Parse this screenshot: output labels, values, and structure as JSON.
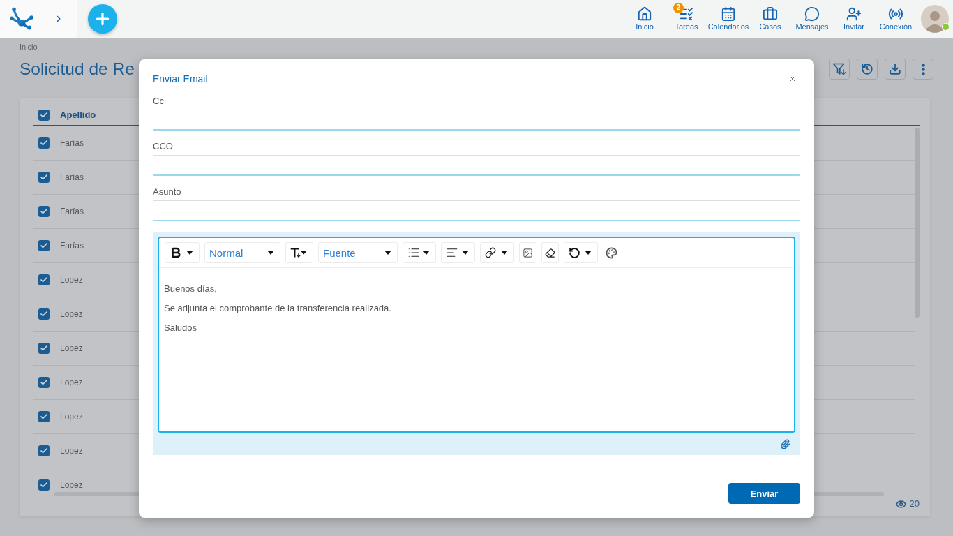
{
  "top_bar": {
    "nav_items": [
      {
        "label": "Inicio"
      },
      {
        "label": "Tareas",
        "badge": "2"
      },
      {
        "label": "Calendarios"
      },
      {
        "label": "Casos"
      },
      {
        "label": "Mensajes"
      },
      {
        "label": "Invitar"
      },
      {
        "label": "Conexión"
      }
    ],
    "user": {
      "online": true
    }
  },
  "page": {
    "breadcrumb": "Inicio",
    "title": "Solicitud de Re"
  },
  "table": {
    "header": {
      "label": "Apellido",
      "checked": true
    },
    "rows": [
      {
        "apellido": "Farías",
        "checked": true
      },
      {
        "apellido": "Farías",
        "checked": true
      },
      {
        "apellido": "Farías",
        "checked": true
      },
      {
        "apellido": "Farías",
        "checked": true
      },
      {
        "apellido": "Lopez",
        "checked": true
      },
      {
        "apellido": "Lopez",
        "checked": true
      },
      {
        "apellido": "Lopez",
        "checked": true
      },
      {
        "apellido": "Lopez",
        "checked": true
      },
      {
        "apellido": "Lopez",
        "checked": true
      },
      {
        "apellido": "Lopez",
        "checked": true
      },
      {
        "apellido": "Lopez",
        "checked": true
      }
    ],
    "visible_count": "20"
  },
  "dialog": {
    "title": "Enviar Email",
    "fields": [
      {
        "label": "Cc"
      },
      {
        "label": "CCO"
      },
      {
        "label": "Asunto"
      }
    ],
    "editor": {
      "heading": "Normal",
      "font": "Fuente",
      "body": [
        "Buenos días,",
        "Se adjunta el comprobante de la transferencia realizada.",
        "Saludos"
      ]
    },
    "send_button": "Enviar"
  }
}
